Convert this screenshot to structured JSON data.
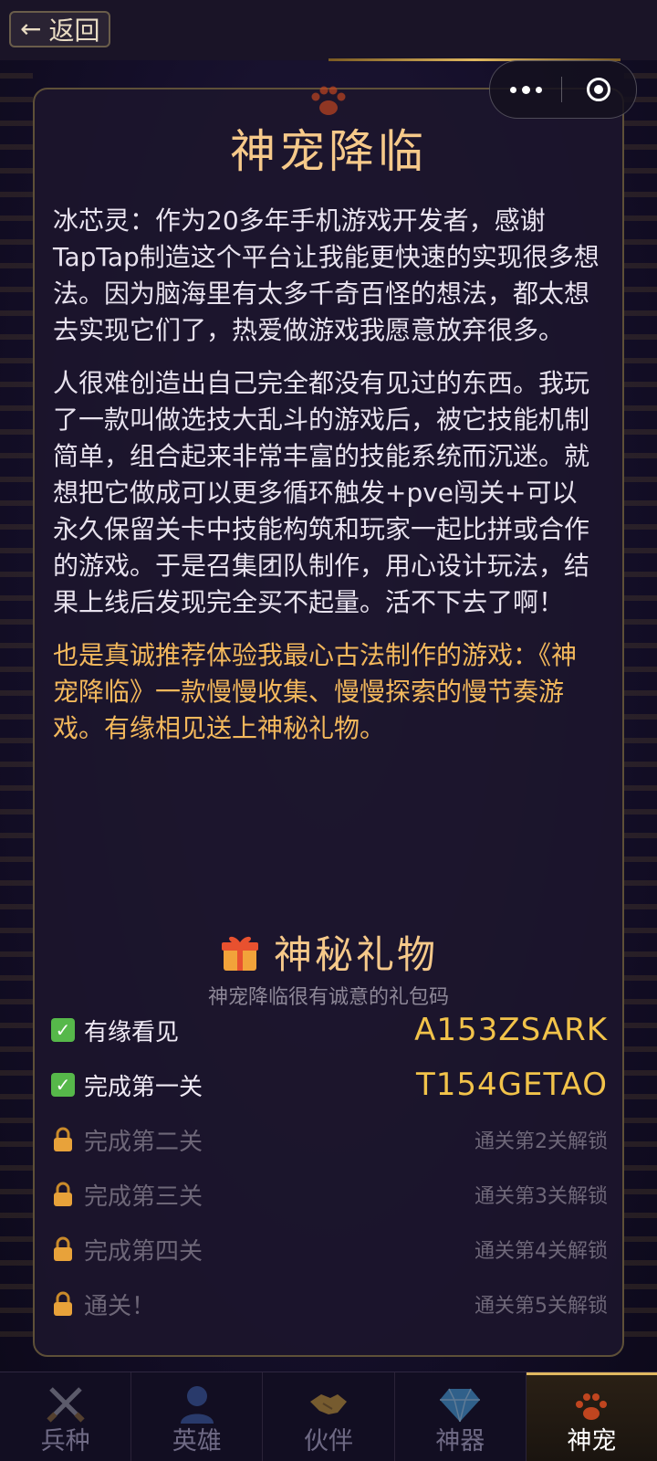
{
  "top_bar": {
    "back_label": "返回"
  },
  "header": {
    "title": "神宠降临"
  },
  "story": {
    "paragraph_1": "冰芯灵：作为20多年手机游戏开发者，感谢TapTap制造这个平台让我能更快速的实现很多想法。因为脑海里有太多千奇百怪的想法，都太想去实现它们了，热爱做游戏我愿意放弃很多。",
    "paragraph_2": "人很难创造出自己完全都没有见过的东西。我玩了一款叫做选技大乱斗的游戏后，被它技能机制简单，组合起来非常丰富的技能系统而沉迷。就想把它做成可以更多循环触发+pve闯关+可以永久保留关卡中技能构筑和玩家一起比拼或合作的游戏。于是召集团队制作，用心设计玩法，结果上线后发现完全买不起量。活不下去了啊！",
    "paragraph_3": "也是真诚推荐体验我最心古法制作的游戏：《神宠降临》一款慢慢收集、慢慢探索的慢节奏游戏。有缘相见送上神秘礼物。"
  },
  "gift": {
    "title": "神秘礼物",
    "subtitle": "神宠降临很有诚意的礼包码",
    "rewards": [
      {
        "label": "有缘看见",
        "status": "unlocked",
        "code": "A153ZSARK"
      },
      {
        "label": "完成第一关",
        "status": "unlocked",
        "code": "T154GETAO"
      },
      {
        "label": "完成第二关",
        "status": "locked",
        "hint": "通关第2关解锁"
      },
      {
        "label": "完成第三关",
        "status": "locked",
        "hint": "通关第3关解锁"
      },
      {
        "label": "完成第四关",
        "status": "locked",
        "hint": "通关第4关解锁"
      },
      {
        "label": "通关！",
        "status": "locked",
        "hint": "通关第5关解锁"
      }
    ]
  },
  "tabbar": {
    "tabs": [
      {
        "label": "兵种",
        "icon": "crossed-swords-icon",
        "active": false
      },
      {
        "label": "英雄",
        "icon": "hero-silhouette-icon",
        "active": false
      },
      {
        "label": "伙伴",
        "icon": "handshake-icon",
        "active": false
      },
      {
        "label": "神器",
        "icon": "diamond-icon",
        "active": false
      },
      {
        "label": "神宠",
        "icon": "paw-icon",
        "active": true
      }
    ]
  },
  "colors": {
    "accent_gold": "#f6c98a",
    "code_gold": "#f2c34a",
    "highlight_text": "#f3b85c",
    "check_green": "#56b84a"
  }
}
